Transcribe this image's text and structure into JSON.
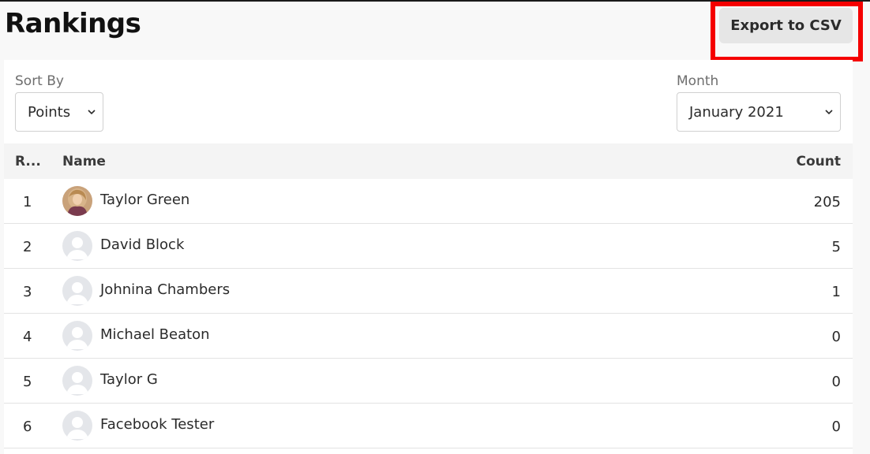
{
  "header": {
    "title": "Rankings",
    "export_label": "Export to CSV"
  },
  "filters": {
    "sort_by_label": "Sort By",
    "sort_by_value": "Points",
    "month_label": "Month",
    "month_value": "January 2021"
  },
  "table": {
    "columns": {
      "rank": "R...",
      "name": "Name",
      "count": "Count"
    },
    "rows": [
      {
        "rank": "1",
        "name": "Taylor Green",
        "count": "205",
        "avatar": "photo"
      },
      {
        "rank": "2",
        "name": "David Block",
        "count": "5",
        "avatar": "default-user-icon"
      },
      {
        "rank": "3",
        "name": "Johnina Chambers",
        "count": "1",
        "avatar": "default-user-icon"
      },
      {
        "rank": "4",
        "name": "Michael Beaton",
        "count": "0",
        "avatar": "default-user-icon"
      },
      {
        "rank": "5",
        "name": "Taylor G",
        "count": "0",
        "avatar": "default-user-icon"
      },
      {
        "rank": "6",
        "name": "Facebook Tester",
        "count": "0",
        "avatar": "default-user-icon"
      }
    ]
  },
  "colors": {
    "highlight": "#f50000",
    "button_bg": "#e6e6e6",
    "header_row_bg": "#f4f4f4"
  }
}
